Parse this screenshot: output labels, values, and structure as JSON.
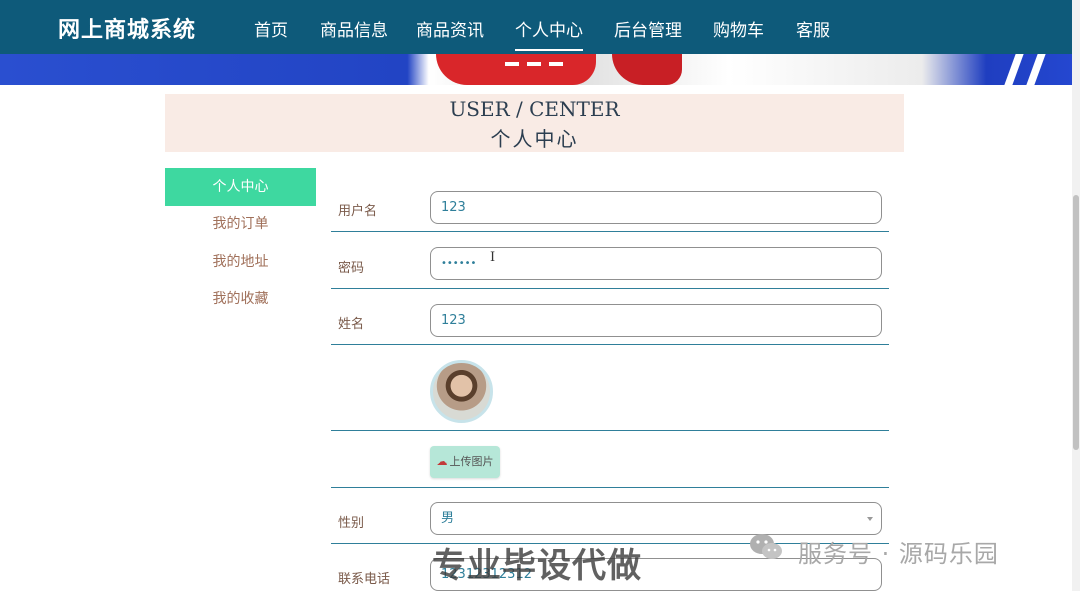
{
  "app": {
    "brand": "网上商城系统"
  },
  "nav": {
    "items": [
      {
        "label": "首页"
      },
      {
        "label": "商品信息"
      },
      {
        "label": "商品资讯"
      },
      {
        "label": "个人中心"
      },
      {
        "label": "后台管理"
      },
      {
        "label": "购物车"
      },
      {
        "label": "客服"
      }
    ],
    "active": "个人中心"
  },
  "header": {
    "title_en": "USER / CENTER",
    "title_cn": "个人中心"
  },
  "sidebar": {
    "items": [
      {
        "label": "个人中心",
        "active": true
      },
      {
        "label": "我的订单"
      },
      {
        "label": "我的地址"
      },
      {
        "label": "我的收藏"
      }
    ]
  },
  "form": {
    "username": {
      "label": "用户名",
      "value": "123"
    },
    "password": {
      "label": "密码",
      "value": "••••••"
    },
    "name": {
      "label": "姓名",
      "value": "123"
    },
    "upload_label": "上传图片",
    "gender": {
      "label": "性别",
      "value": "男"
    },
    "phone": {
      "label": "联系电话",
      "value": "12312312312"
    }
  },
  "watermarks": {
    "overlay": "专业毕设代做",
    "account": "服务号 · 源码乐园"
  },
  "colors": {
    "nav_bg": "#0e5a7a",
    "sidebar_active": "#3ed8a0",
    "title_band": "#f9ebe5",
    "row_line": "#2f7f9a"
  },
  "icons": {
    "cursor": "text-cursor-icon",
    "upload": "cloud-upload-icon",
    "select": "chevron-down-icon",
    "wechat": "wechat-icon"
  }
}
